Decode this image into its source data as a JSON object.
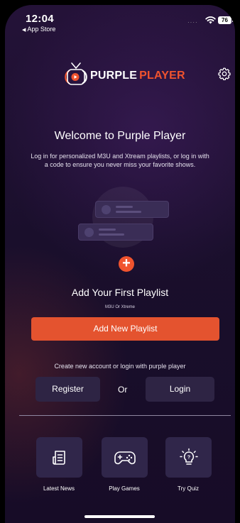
{
  "status_bar": {
    "time": "12:04",
    "back_label": "App Store",
    "battery": "76"
  },
  "header": {
    "logo_text_primary": "PURPLE",
    "logo_text_accent": "PLAYER",
    "settings_icon": "gear-icon"
  },
  "welcome": {
    "title": "Welcome to Purple Player",
    "subtitle": "Log in for personalized M3U and Xtream playlists, or log in with a code to ensure you never miss your favorite shows."
  },
  "playlist": {
    "title": "Add Your First Playlist",
    "subtitle": "M3U Or Xtreme",
    "add_button": "Add New Playlist"
  },
  "account": {
    "prompt": "Create new account or login with purple player",
    "register_button": "Register",
    "or_label": "Or",
    "login_button": "Login"
  },
  "features": [
    {
      "label": "Latest News",
      "icon": "news-icon"
    },
    {
      "label": "Play Games",
      "icon": "gamepad-icon"
    },
    {
      "label": "Try Quiz",
      "icon": "lightbulb-icon"
    }
  ],
  "colors": {
    "accent": "#f0532e",
    "background": "#1a0f2c",
    "button_dark": "#2e2444"
  }
}
